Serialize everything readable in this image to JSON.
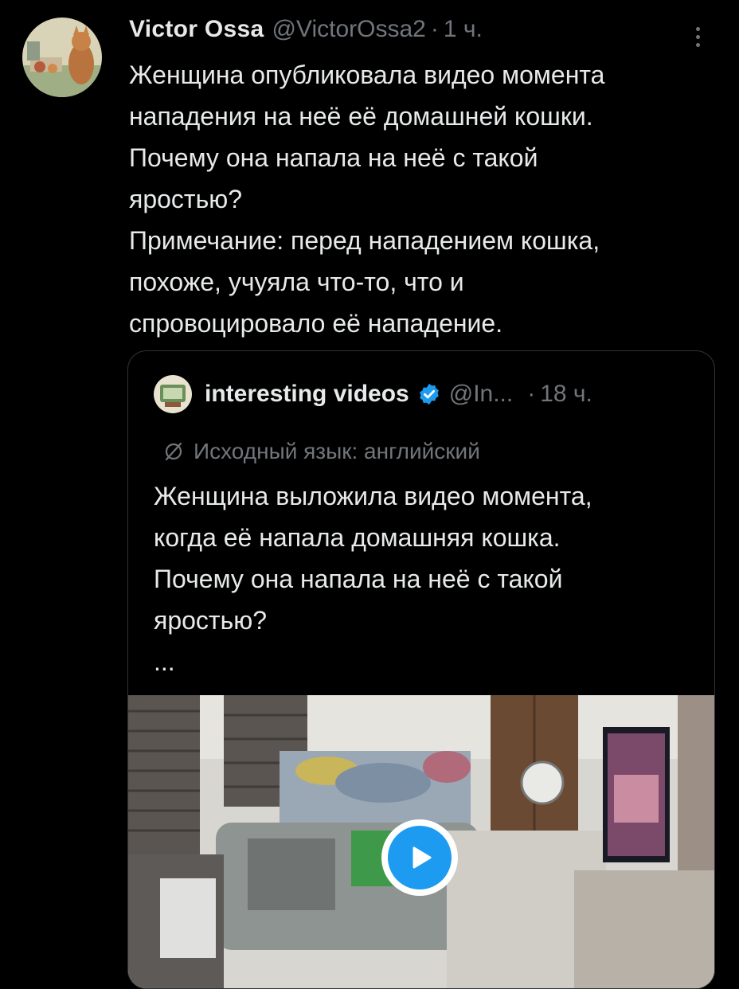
{
  "tweet": {
    "author_name": "Victor Ossa",
    "author_handle": "@VictorOssa2",
    "separator": "·",
    "time": "1 ч.",
    "text_lines": [
      "Женщина опубликовала видео момента",
      "нападения на неё её домашней кошки.",
      "Почему она напала на неё с такой",
      "яростью?",
      "Примечание: перед нападением кошка,",
      "похоже, учуяла что-то, что и",
      "спровоцировало её нападение."
    ]
  },
  "quote": {
    "author_name": "interesting videos",
    "author_handle": "@In...",
    "separator": "·",
    "time": "18 ч.",
    "translation_note": "Исходный язык: английский",
    "text_lines": [
      "Женщина выложила видео момента,",
      "когда её напала домашняя кошка.",
      "Почему она напала на неё с такой",
      "яростью?"
    ],
    "ellipsis": "..."
  },
  "colors": {
    "background": "#000000",
    "text": "#e7e9ea",
    "muted": "#71767b",
    "border": "#2f3336",
    "accent": "#1d9bf0"
  },
  "icons": {
    "more": "more-vertical-icon",
    "verified": "verified-badge-icon",
    "translate": "translate-icon",
    "play": "play-icon"
  }
}
